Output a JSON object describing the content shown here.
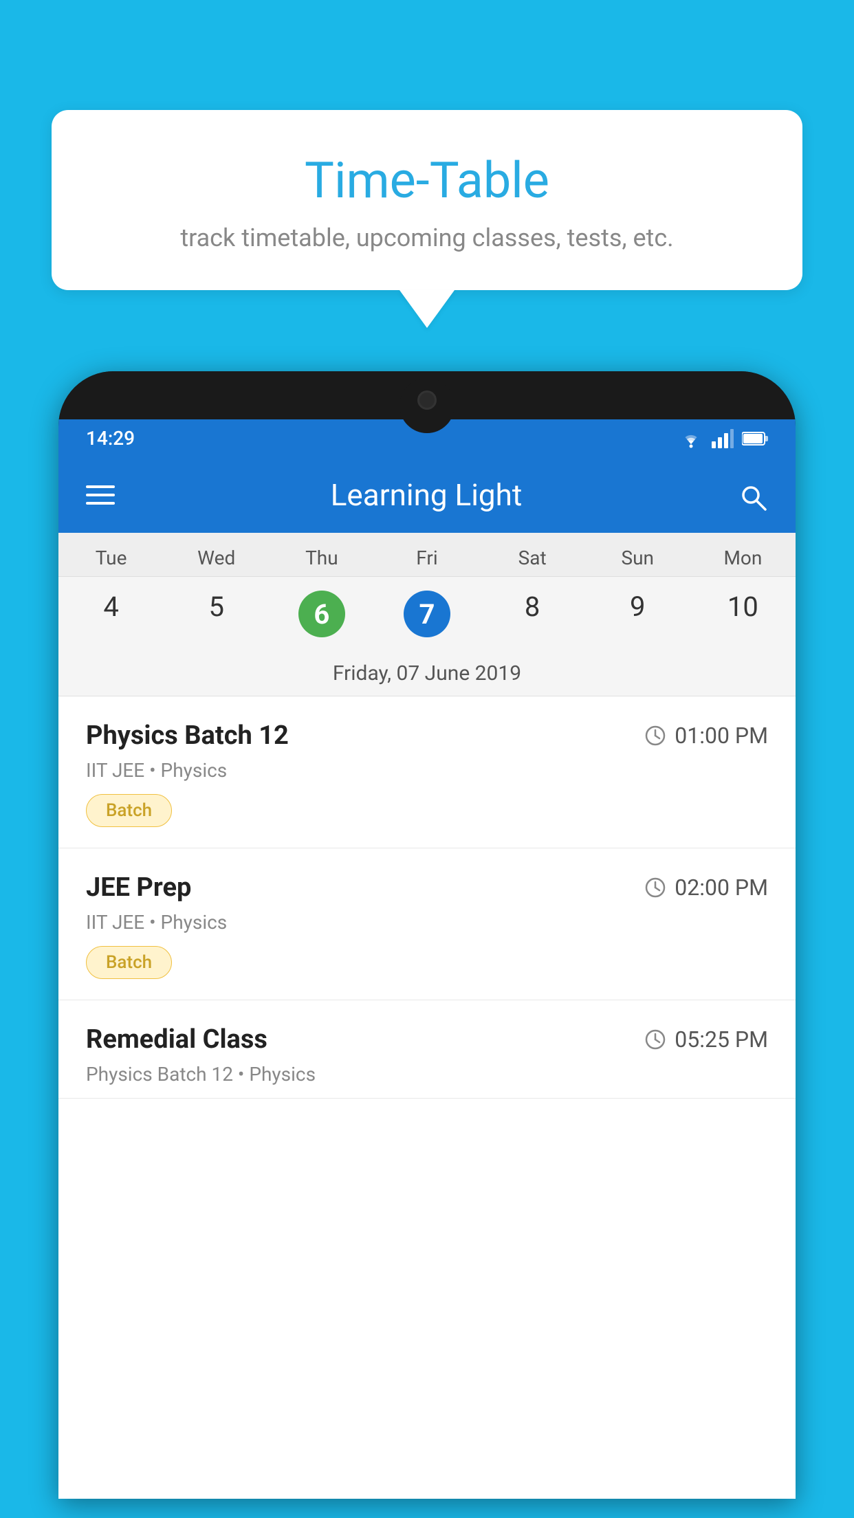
{
  "background_color": "#1AB8E8",
  "speech_bubble": {
    "title": "Time-Table",
    "subtitle": "track timetable, upcoming classes, tests, etc."
  },
  "phone": {
    "status_bar": {
      "time": "14:29"
    },
    "toolbar": {
      "title": "Learning Light"
    },
    "calendar": {
      "days": [
        "Tue",
        "Wed",
        "Thu",
        "Fri",
        "Sat",
        "Sun",
        "Mon"
      ],
      "dates": [
        "4",
        "5",
        "6",
        "7",
        "8",
        "9",
        "10"
      ],
      "today_index": 2,
      "selected_index": 3,
      "selected_date_label": "Friday, 07 June 2019"
    },
    "schedule_items": [
      {
        "title": "Physics Batch 12",
        "time": "01:00 PM",
        "subtitle": "IIT JEE • Physics",
        "badge": "Batch"
      },
      {
        "title": "JEE Prep",
        "time": "02:00 PM",
        "subtitle": "IIT JEE • Physics",
        "badge": "Batch"
      },
      {
        "title": "Remedial Class",
        "time": "05:25 PM",
        "subtitle": "Physics Batch 12 • Physics",
        "badge": ""
      }
    ]
  }
}
